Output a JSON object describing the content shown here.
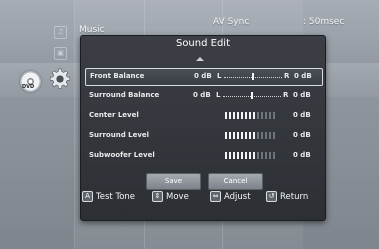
{
  "background": {
    "menu_title": "Music",
    "av_sync_label": "AV Sync",
    "av_sync_value": ": 50msec",
    "disc_label": "DVD"
  },
  "dialog": {
    "title": "Sound Edit",
    "rows": [
      {
        "label": "Front Balance",
        "value": "0 dB",
        "left": "L",
        "right": "R",
        "right_value": "0 dB",
        "balance_pos": 0.5
      },
      {
        "label": "Surround Balance",
        "value": "0 dB",
        "left": "L",
        "right": "R",
        "right_value": "0 dB",
        "balance_pos": 0.5
      },
      {
        "label": "Center Level",
        "value": "0 dB",
        "level": 0.6
      },
      {
        "label": "Surround Level",
        "value": "0 dB",
        "level": 0.6
      },
      {
        "label": "Subwoofer Level",
        "value": "0 dB",
        "level": 0.6
      }
    ],
    "save_label": "Save",
    "cancel_label": "Cancel"
  },
  "help": {
    "test_tone_key": "A",
    "test_tone_label": "Test Tone",
    "move_label": "Move",
    "adjust_label": "Adjust",
    "return_label": "Return"
  }
}
